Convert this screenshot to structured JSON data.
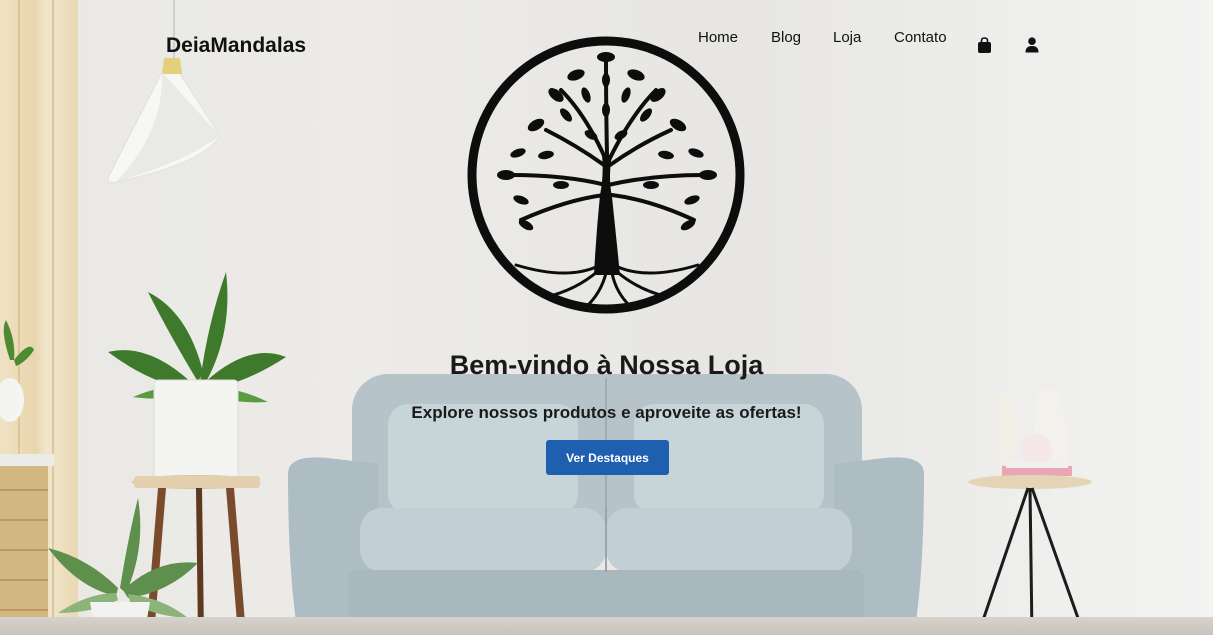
{
  "header": {
    "brand": "DeiaMandalas",
    "nav": [
      {
        "label": "Home"
      },
      {
        "label": "Blog"
      },
      {
        "label": "Loja"
      },
      {
        "label": "Contato"
      }
    ],
    "icons": [
      "shopping-bag-icon",
      "user-icon"
    ]
  },
  "hero": {
    "title": "Bem-vindo à Nossa Loja",
    "subtitle": "Explore nossos produtos e aproveite as ofertas!",
    "cta_label": "Ver Destaques"
  },
  "colors": {
    "accent": "#1f5fb0",
    "text": "#111111",
    "wall": "#eceae7",
    "sofa": "#b7c5cb"
  }
}
